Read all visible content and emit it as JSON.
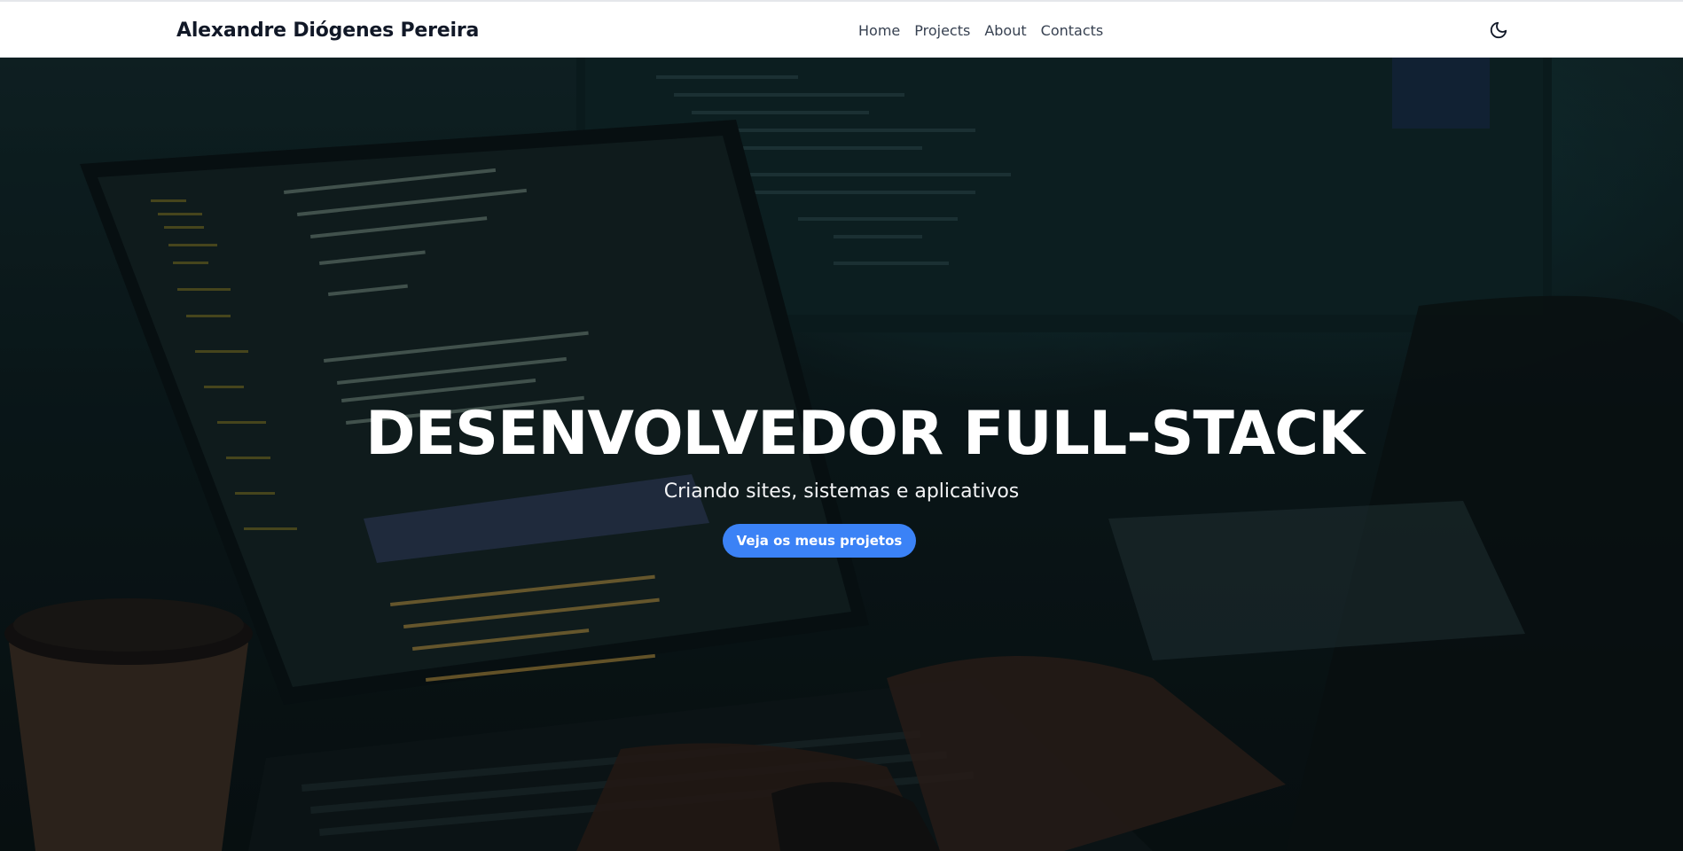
{
  "navbar": {
    "brand": "Alexandre Diógenes Pereira",
    "links": [
      {
        "label": "Home"
      },
      {
        "label": "Projects"
      },
      {
        "label": "About"
      },
      {
        "label": "Contacts"
      }
    ],
    "theme_toggle_icon": "moon-icon"
  },
  "hero": {
    "title": "DESENVOLVEDOR FULL-STACK",
    "subtitle": "Criando sites, sistemas e aplicativos",
    "cta_label": "Veja os meus projetos",
    "background_icon": "laptop-code-photo"
  },
  "colors": {
    "accent": "#3b82f6",
    "navbar_bg": "#ffffff",
    "hero_text": "#ffffff"
  }
}
